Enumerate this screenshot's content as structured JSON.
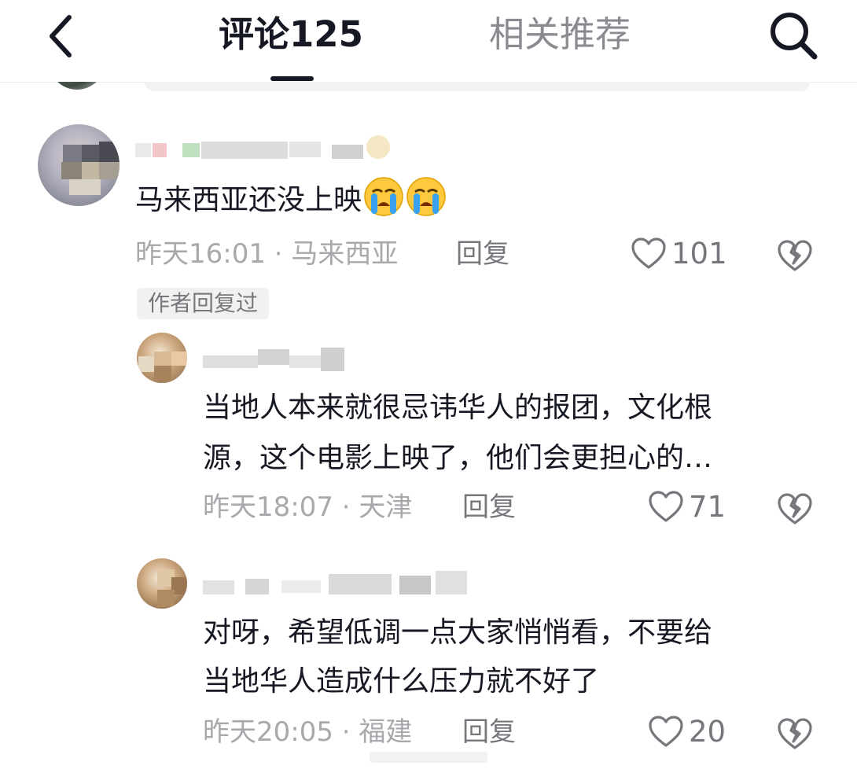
{
  "header": {
    "tab_comments": "评论125",
    "tab_related": "相关推荐",
    "back_icon": "chevron-left-icon",
    "search_icon": "search-icon"
  },
  "comments": [
    {
      "text": "马来西亚还没上映",
      "emojis": [
        "crying-face",
        "crying-face"
      ],
      "time": "昨天16:01",
      "location": "马来西亚",
      "reply_label": "回复",
      "likes": "101",
      "author_replied_badge": "作者回复过"
    }
  ],
  "replies": [
    {
      "text_line1": "当地人本来就很忌讳华人的报团，文化根",
      "text_line2": "源，这个电影上映了，他们会更担心的…",
      "time": "昨天18:07",
      "location": "天津",
      "reply_label": "回复",
      "likes": "71"
    },
    {
      "text_line1": "对呀，希望低调一点大家悄悄看，不要给",
      "text_line2": "当地华人造成什么压力就不好了",
      "time": "昨天20:05",
      "location": "福建",
      "reply_label": "回复",
      "likes": "20"
    }
  ],
  "meta_separator": " · ",
  "colors": {
    "primary_text": "#161823",
    "secondary_text": "#a8a9ad",
    "action_text": "#76777c",
    "badge_bg": "#f1f1f2"
  }
}
